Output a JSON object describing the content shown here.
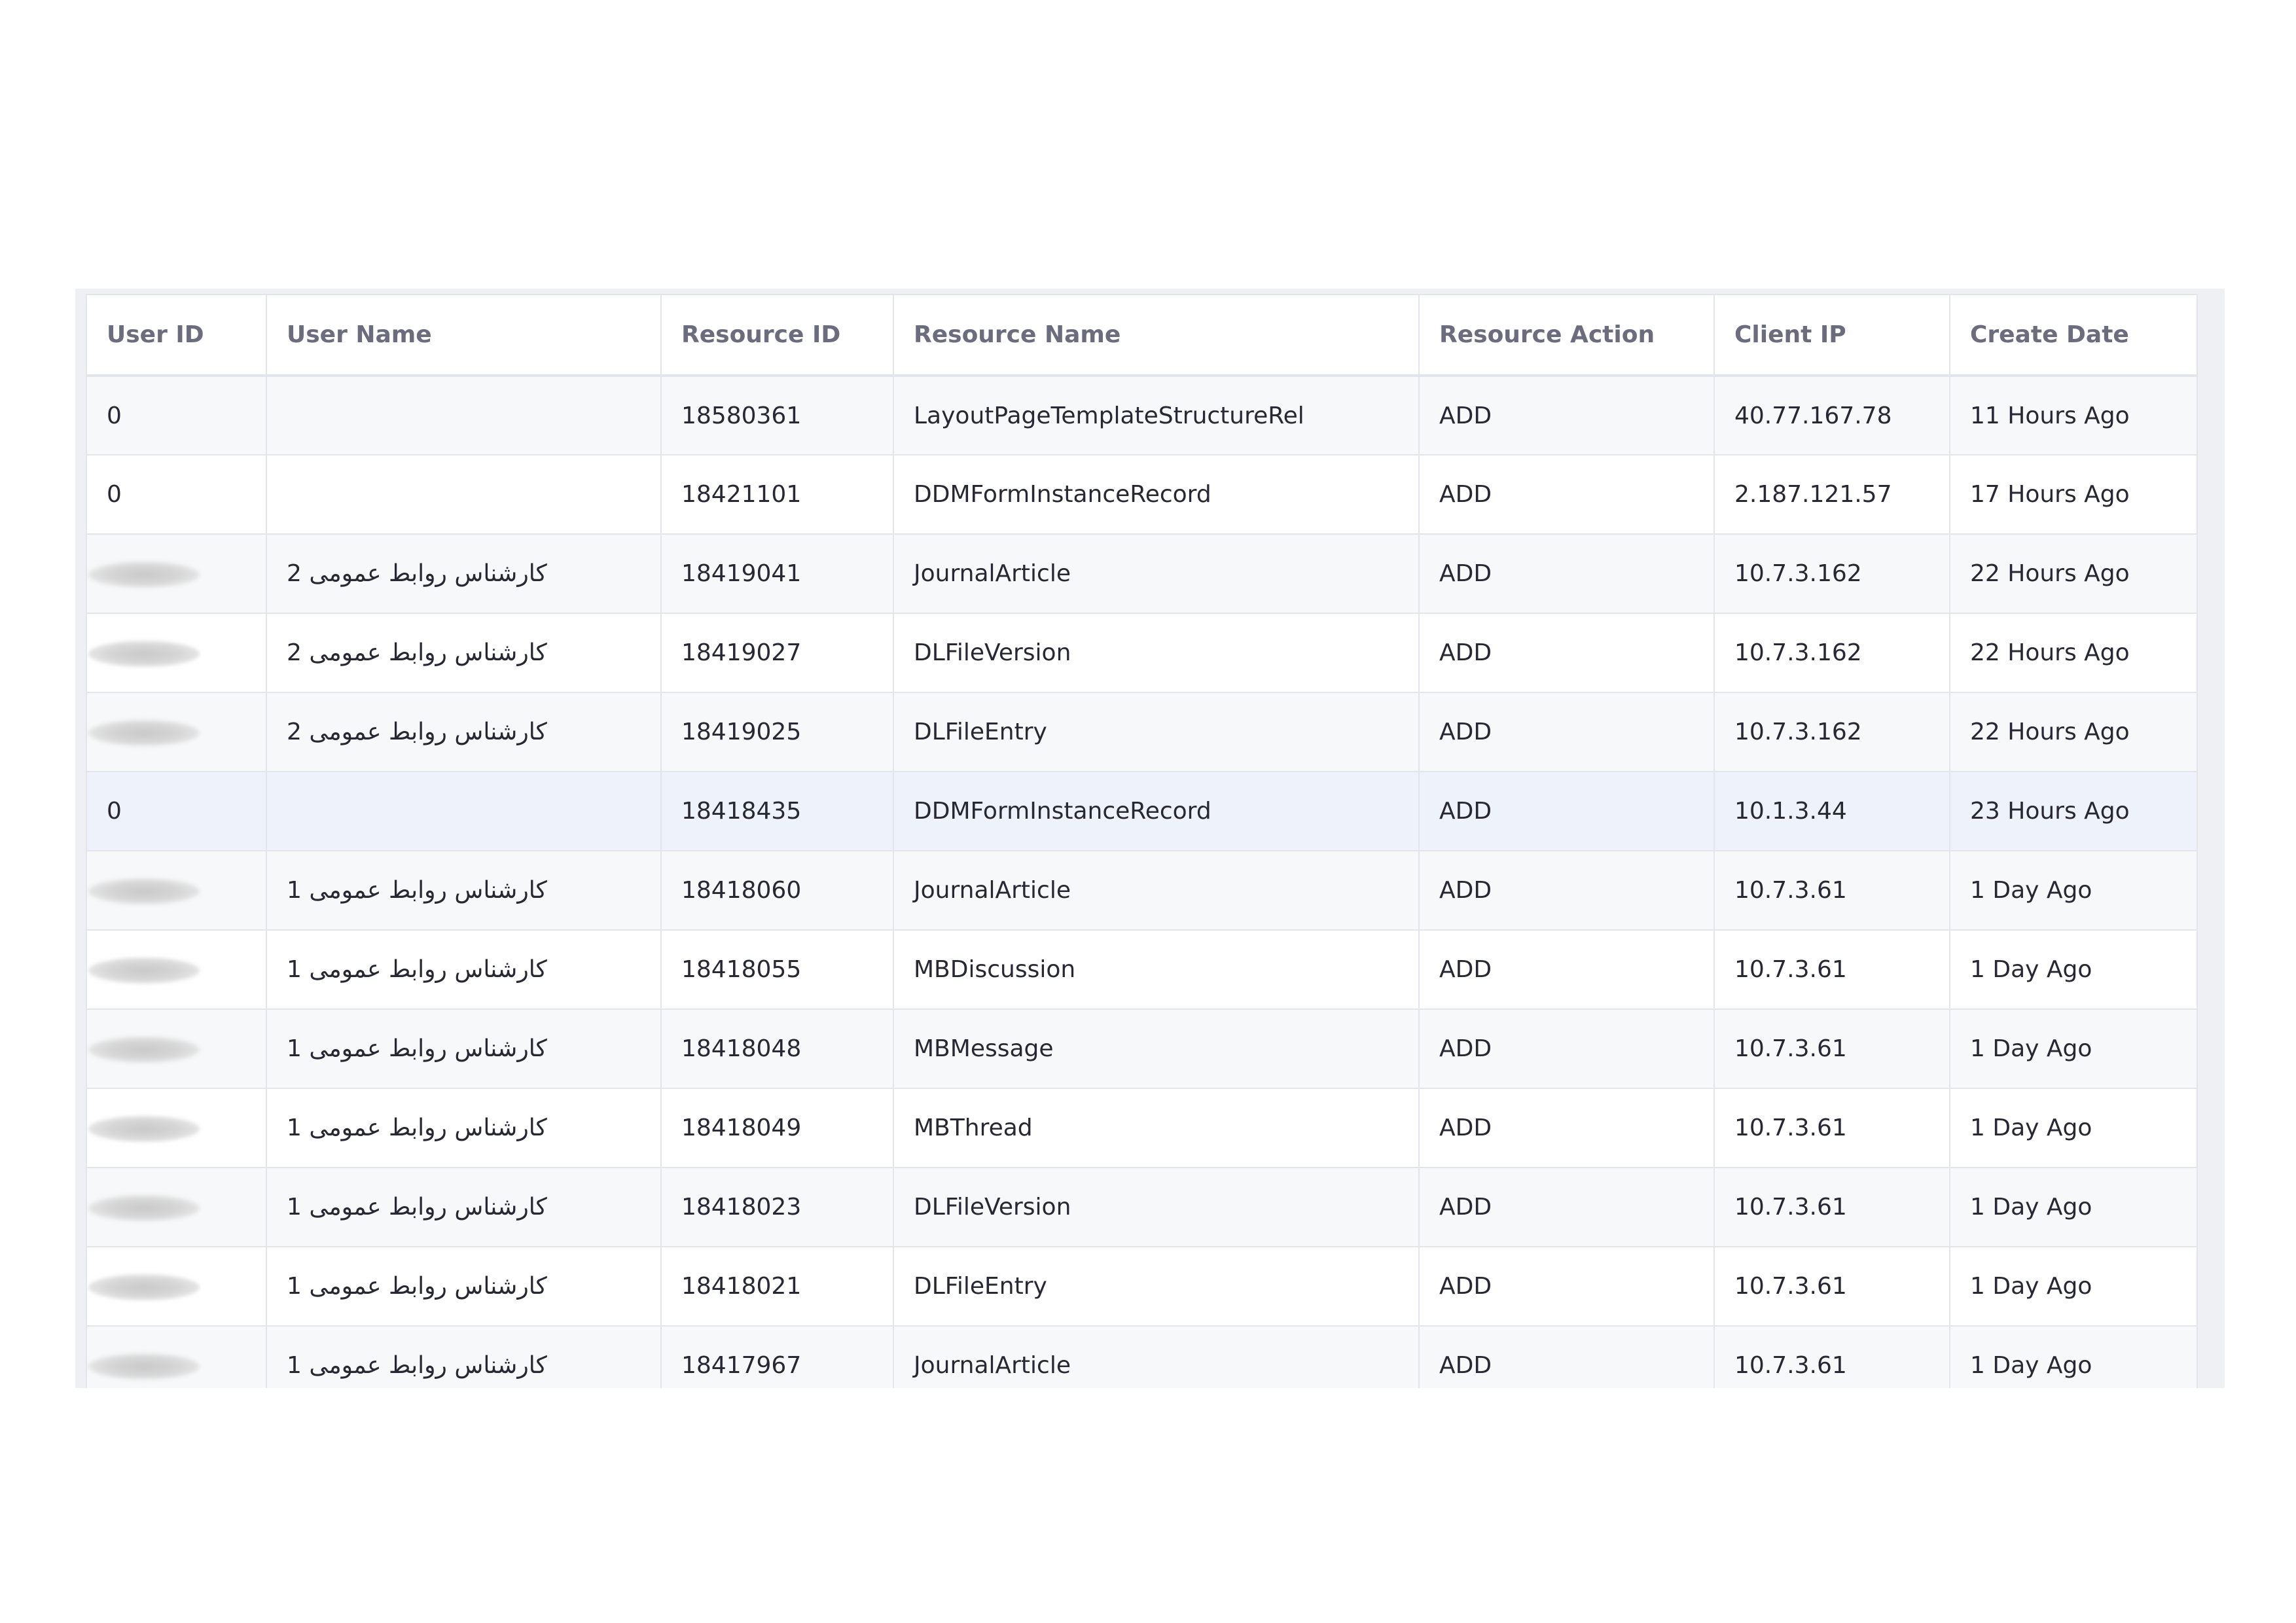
{
  "table": {
    "columns": [
      "User ID",
      "User Name",
      "Resource ID",
      "Resource Name",
      "Resource Action",
      "Client IP",
      "Create Date"
    ],
    "rows": [
      {
        "user_id": "0",
        "user_id_redacted": false,
        "user_name": "",
        "resource_id": "18580361",
        "resource_name": "LayoutPageTemplateStructureRel",
        "resource_action": "ADD",
        "client_ip": "40.77.167.78",
        "create_date": "11 Hours Ago"
      },
      {
        "user_id": "0",
        "user_id_redacted": false,
        "user_name": "",
        "resource_id": "18421101",
        "resource_name": "DDMFormInstanceRecord",
        "resource_action": "ADD",
        "client_ip": "2.187.121.57",
        "create_date": "17 Hours Ago"
      },
      {
        "user_id": "",
        "user_id_redacted": true,
        "user_name": "کارشناس روابط عمومی 2",
        "resource_id": "18419041",
        "resource_name": "JournalArticle",
        "resource_action": "ADD",
        "client_ip": "10.7.3.162",
        "create_date": "22 Hours Ago"
      },
      {
        "user_id": "",
        "user_id_redacted": true,
        "user_name": "کارشناس روابط عمومی 2",
        "resource_id": "18419027",
        "resource_name": "DLFileVersion",
        "resource_action": "ADD",
        "client_ip": "10.7.3.162",
        "create_date": "22 Hours Ago"
      },
      {
        "user_id": "",
        "user_id_redacted": true,
        "user_name": "کارشناس روابط عمومی 2",
        "resource_id": "18419025",
        "resource_name": "DLFileEntry",
        "resource_action": "ADD",
        "client_ip": "10.7.3.162",
        "create_date": "22 Hours Ago"
      },
      {
        "user_id": "0",
        "user_id_redacted": false,
        "user_name": "",
        "resource_id": "18418435",
        "resource_name": "DDMFormInstanceRecord",
        "resource_action": "ADD",
        "client_ip": "10.1.3.44",
        "create_date": "23 Hours Ago",
        "highlighted": true
      },
      {
        "user_id": "",
        "user_id_redacted": true,
        "user_name": "کارشناس روابط عمومی 1",
        "resource_id": "18418060",
        "resource_name": "JournalArticle",
        "resource_action": "ADD",
        "client_ip": "10.7.3.61",
        "create_date": "1 Day Ago"
      },
      {
        "user_id": "",
        "user_id_redacted": true,
        "user_name": "کارشناس روابط عمومی 1",
        "resource_id": "18418055",
        "resource_name": "MBDiscussion",
        "resource_action": "ADD",
        "client_ip": "10.7.3.61",
        "create_date": "1 Day Ago"
      },
      {
        "user_id": "",
        "user_id_redacted": true,
        "user_name": "کارشناس روابط عمومی 1",
        "resource_id": "18418048",
        "resource_name": "MBMessage",
        "resource_action": "ADD",
        "client_ip": "10.7.3.61",
        "create_date": "1 Day Ago"
      },
      {
        "user_id": "",
        "user_id_redacted": true,
        "user_name": "کارشناس روابط عمومی 1",
        "resource_id": "18418049",
        "resource_name": "MBThread",
        "resource_action": "ADD",
        "client_ip": "10.7.3.61",
        "create_date": "1 Day Ago"
      },
      {
        "user_id": "",
        "user_id_redacted": true,
        "user_name": "کارشناس روابط عمومی 1",
        "resource_id": "18418023",
        "resource_name": "DLFileVersion",
        "resource_action": "ADD",
        "client_ip": "10.7.3.61",
        "create_date": "1 Day Ago"
      },
      {
        "user_id": "",
        "user_id_redacted": true,
        "user_name": "کارشناس روابط عمومی 1",
        "resource_id": "18418021",
        "resource_name": "DLFileEntry",
        "resource_action": "ADD",
        "client_ip": "10.7.3.61",
        "create_date": "1 Day Ago"
      },
      {
        "user_id": "",
        "user_id_redacted": true,
        "user_name": "کارشناس روابط عمومی 1",
        "resource_id": "18417967",
        "resource_name": "JournalArticle",
        "resource_action": "ADD",
        "client_ip": "10.7.3.61",
        "create_date": "1 Day Ago"
      }
    ]
  },
  "colors": {
    "header_text": "#6b6c7e",
    "cell_text": "#272833",
    "border": "#e3e5ea",
    "row_alt": "#f7f8f9",
    "row_highlight": "#eef2fa",
    "frame": "#eef0f4"
  }
}
